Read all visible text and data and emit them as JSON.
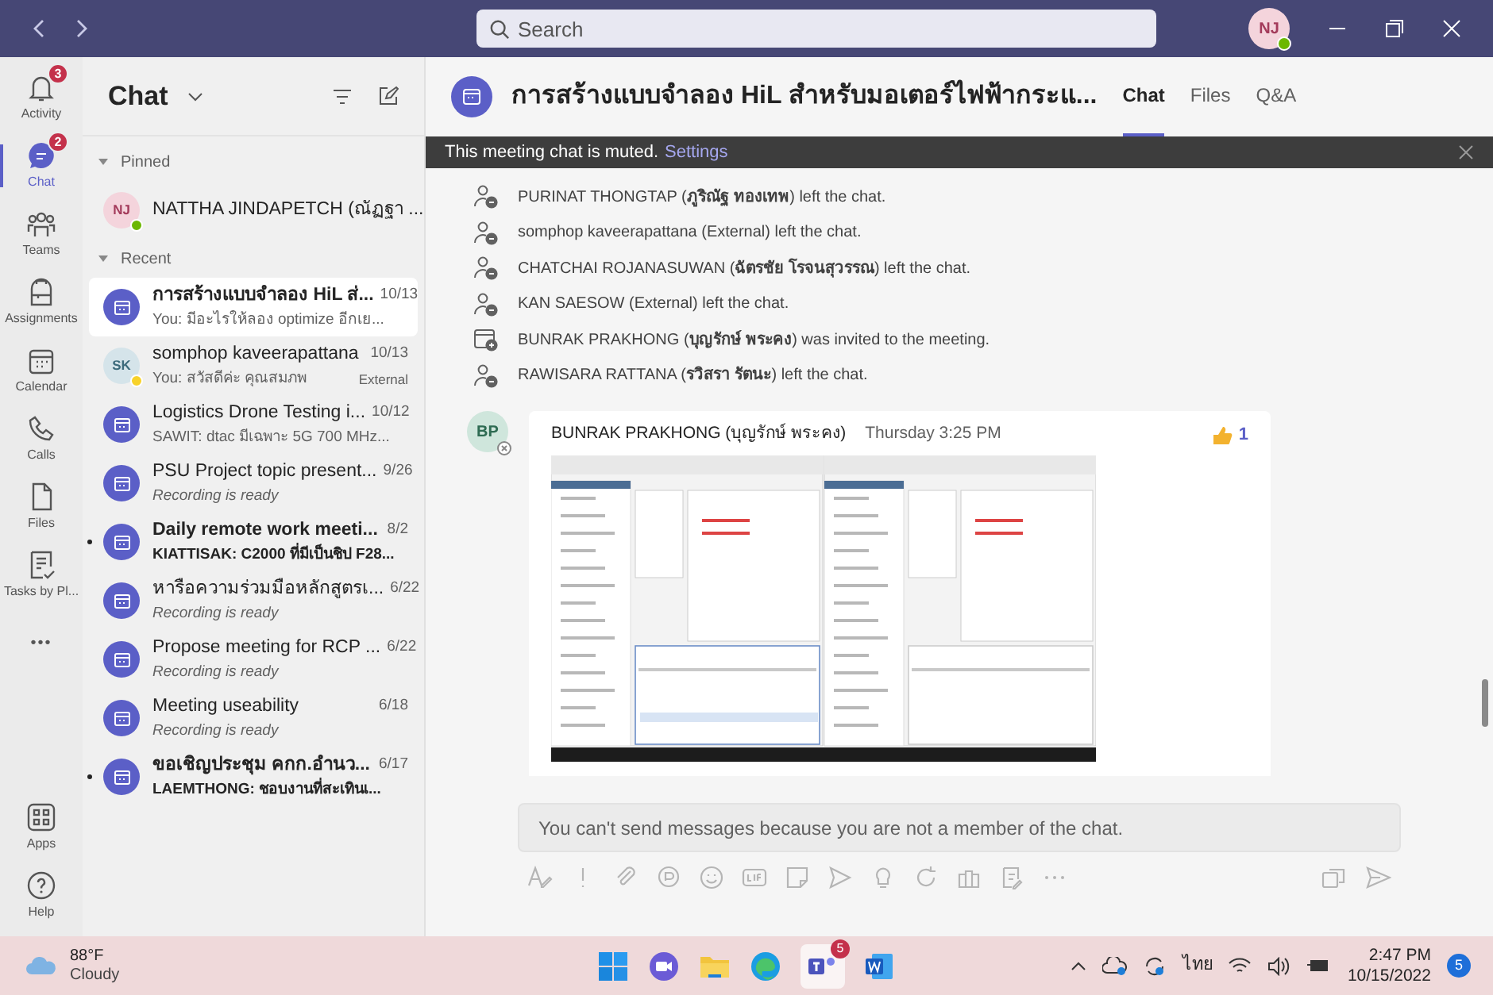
{
  "title_bar": {
    "search_placeholder": "Search",
    "avatar": "NJ"
  },
  "rail": [
    {
      "kind": "activity",
      "label": "Activity",
      "badge": "3",
      "selected": false
    },
    {
      "kind": "chat",
      "label": "Chat",
      "badge": "2",
      "selected": true
    },
    {
      "kind": "teams",
      "label": "Teams",
      "selected": false
    },
    {
      "kind": "assignments",
      "label": "Assignments",
      "selected": false
    },
    {
      "kind": "calendar",
      "label": "Calendar",
      "selected": false
    },
    {
      "kind": "calls",
      "label": "Calls",
      "selected": false
    },
    {
      "kind": "files",
      "label": "Files",
      "selected": false
    },
    {
      "kind": "tasks",
      "label": "Tasks by Pl...",
      "selected": false
    },
    {
      "kind": "more",
      "label": "•••",
      "selected": false
    }
  ],
  "rail_bottom": [
    {
      "kind": "apps",
      "label": "Apps"
    },
    {
      "kind": "help",
      "label": "Help"
    }
  ],
  "chat_list": {
    "title": "Chat",
    "sections": [
      {
        "label": "Pinned",
        "items": [
          {
            "kind": "person",
            "initials": "NJ",
            "color": "#6bb700",
            "name": "NATTHA JINDAPETCH (ณัฏฐา ...",
            "selected": false,
            "unread": false
          }
        ]
      },
      {
        "label": "Recent",
        "items": [
          {
            "kind": "meeting",
            "name": "การสร้างแบบจำลอง HiL ส่...",
            "date": "10/13",
            "preview": "You: มีอะไรให้ลอง optimize อีกเย...",
            "italic": false,
            "selected": true,
            "unread": false
          },
          {
            "kind": "person",
            "initials": "SK",
            "color": "#f8d22a",
            "name": "somphop kaveerapattana",
            "date": "10/13",
            "preview": "You: สวัสดีค่ะ คุณสมภพ",
            "tag": "External",
            "italic": false,
            "selected": false,
            "unread": false
          },
          {
            "kind": "meeting",
            "name": "Logistics Drone Testing i...",
            "date": "10/12",
            "preview": "SAWIT: dtac มีเฉพาะ 5G 700 MHz...",
            "italic": false,
            "selected": false,
            "unread": false
          },
          {
            "kind": "meeting",
            "name": "PSU Project topic present...",
            "date": "9/26",
            "preview": "Recording is ready",
            "italic": true,
            "selected": false,
            "unread": false
          },
          {
            "kind": "meeting",
            "name": "Daily remote work meeti...",
            "date": "8/2",
            "preview": "KIATTISAK: C2000 ที่มีเป็นชิป F28...",
            "italic": false,
            "selected": false,
            "unread": true
          },
          {
            "kind": "meeting",
            "name": "หารือความร่วมมือหลักสูตรเ...",
            "date": "6/22",
            "preview": "Recording is ready",
            "italic": true,
            "selected": false,
            "unread": false
          },
          {
            "kind": "meeting",
            "name": "Propose meeting for RCP ...",
            "date": "6/22",
            "preview": "Recording is ready",
            "italic": true,
            "selected": false,
            "unread": false
          },
          {
            "kind": "meeting",
            "name": "Meeting useability",
            "date": "6/18",
            "preview": "Recording is ready",
            "italic": true,
            "selected": false,
            "unread": false
          },
          {
            "kind": "meeting",
            "name": "ขอเชิญประชุม คกก.อำนว...",
            "date": "6/17",
            "preview": "LAEMTHONG: ชอบงานที่สะเทินเ...",
            "italic": false,
            "selected": false,
            "unread": true
          }
        ]
      }
    ]
  },
  "meeting": {
    "title": "การสร้างแบบจำลอง HiL สำหรับมอเตอร์ไฟฟ้ากระแ...",
    "tabs": [
      {
        "label": "Chat",
        "selected": true
      },
      {
        "label": "Files",
        "selected": false
      },
      {
        "label": "Q&A",
        "selected": false
      }
    ],
    "banner": {
      "text": "This meeting chat is muted.",
      "link": "Settings"
    },
    "events": [
      {
        "kind": "left",
        "text": "PURINAT THONGTAP (**ภูริณัฐ ทองเทพ**) left the chat."
      },
      {
        "kind": "left",
        "text": "somphop kaveerapattana (External) left the chat."
      },
      {
        "kind": "left",
        "text": "CHATCHAI ROJANASUWAN (**ฉัตรชัย โรจนสุวรรณ**) left the chat."
      },
      {
        "kind": "left",
        "text": "KAN SAESOW (External) left the chat."
      },
      {
        "kind": "invited",
        "text": "BUNRAK PRAKHONG (**บุญรักษ์ พระคง**) was invited to the meeting."
      },
      {
        "kind": "left",
        "text": "RAWISARA RATTANA (**รวิสรา รัตนะ**) left the chat."
      }
    ],
    "message": {
      "initials": "BP",
      "author": "BUNRAK PRAKHONG (บุญรักษ์ พระคง)",
      "time": "Thursday 3:25 PM",
      "reaction_count": "1"
    },
    "compose_notice": "You can't send messages because you are not a member of the chat."
  },
  "taskbar": {
    "temperature": "88°F",
    "condition": "Cloudy",
    "teams_badge": "5",
    "language": "ไทย",
    "time": "2:47 PM",
    "date": "10/15/2022",
    "notifications": "5"
  }
}
